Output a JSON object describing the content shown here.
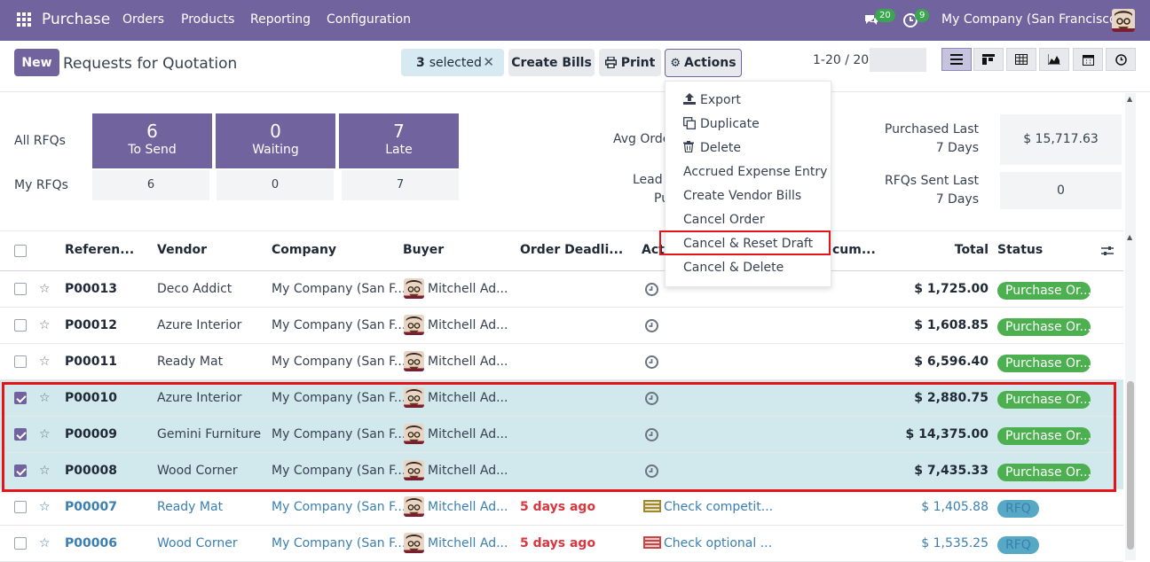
{
  "topbar": {
    "app_name": "Purchase",
    "menu": [
      "Orders",
      "Products",
      "Reporting",
      "Configuration"
    ],
    "chat_count": "20",
    "activity_count": "9",
    "company": "My Company (San Francisco)"
  },
  "control": {
    "new_label": "New",
    "title": "Requests for Quotation",
    "selected_count": "3",
    "selected_label": "selected",
    "create_bills": "Create Bills",
    "print": "Print",
    "actions": "Actions",
    "pager": "1-20 / 20"
  },
  "actions_menu": {
    "items": [
      "Export",
      "Duplicate",
      "Delete",
      "Accrued Expense Entry",
      "Create Vendor Bills",
      "Cancel Order",
      "Cancel & Reset Draft",
      "Cancel & Delete"
    ]
  },
  "dashboard": {
    "all_rfqs": "All RFQs",
    "my_rfqs": "My RFQs",
    "tiles": [
      {
        "value": "6",
        "label": "To Send",
        "mine": "6"
      },
      {
        "value": "0",
        "label": "Waiting",
        "mine": "0"
      },
      {
        "value": "7",
        "label": "Late",
        "mine": "7"
      }
    ],
    "avg_order": "Avg Orde",
    "lead_t": "Lead T",
    "pu": "Pu",
    "purchased_label": "Purchased Last 7 Days",
    "purchased_value": "$ 15,717.63",
    "sent_label": "RFQs Sent Last 7 Days",
    "sent_value": "0"
  },
  "table": {
    "headers": {
      "reference": "Referen...",
      "vendor": "Vendor",
      "company": "Company",
      "buyer": "Buyer",
      "deadline": "Order Deadli...",
      "activities": "Acti",
      "source_doc": "cum...",
      "total": "Total",
      "status": "Status"
    },
    "rows": [
      {
        "ref": "P00013",
        "vendor": "Deco Addict",
        "company": "My Company (San F...",
        "buyer": "Mitchell Ad...",
        "deadline": "",
        "activity": "",
        "total": "$ 1,725.00",
        "status": "Purchase Or...",
        "selected": false
      },
      {
        "ref": "P00012",
        "vendor": "Azure Interior",
        "company": "My Company (San F...",
        "buyer": "Mitchell Ad...",
        "deadline": "",
        "activity": "",
        "total": "$ 1,608.85",
        "status": "Purchase Or...",
        "selected": false
      },
      {
        "ref": "P00011",
        "vendor": "Ready Mat",
        "company": "My Company (San F...",
        "buyer": "Mitchell Ad...",
        "deadline": "",
        "activity": "",
        "total": "$ 6,596.40",
        "status": "Purchase Or...",
        "selected": false
      },
      {
        "ref": "P00010",
        "vendor": "Azure Interior",
        "company": "My Company (San F...",
        "buyer": "Mitchell Ad...",
        "deadline": "",
        "activity": "",
        "total": "$ 2,880.75",
        "status": "Purchase Or...",
        "selected": true
      },
      {
        "ref": "P00009",
        "vendor": "Gemini Furniture",
        "company": "My Company (San F...",
        "buyer": "Mitchell Ad...",
        "deadline": "",
        "activity": "",
        "total": "$ 14,375.00",
        "status": "Purchase Or...",
        "selected": true
      },
      {
        "ref": "P00008",
        "vendor": "Wood Corner",
        "company": "My Company (San F...",
        "buyer": "Mitchell Ad...",
        "deadline": "",
        "activity": "",
        "total": "$ 7,435.33",
        "status": "Purchase Or...",
        "selected": true
      },
      {
        "ref": "P00007",
        "vendor": "Ready Mat",
        "company": "My Company (San F...",
        "buyer": "Mitchell Ad...",
        "deadline": "5 days ago",
        "activity": "Check competit...",
        "total": "$ 1,405.88",
        "status": "RFQ",
        "selected": false
      },
      {
        "ref": "P00006",
        "vendor": "Wood Corner",
        "company": "My Company (San F...",
        "buyer": "Mitchell Ad...",
        "deadline": "5 days ago",
        "activity": "Check optional ...",
        "total": "$ 1,535.25",
        "status": "RFQ",
        "selected": false
      }
    ]
  },
  "colors": {
    "brand": "#71639e",
    "highlight": "#e5141b",
    "po_status": "#4caf50",
    "rfq_status": "#56a8c4"
  }
}
